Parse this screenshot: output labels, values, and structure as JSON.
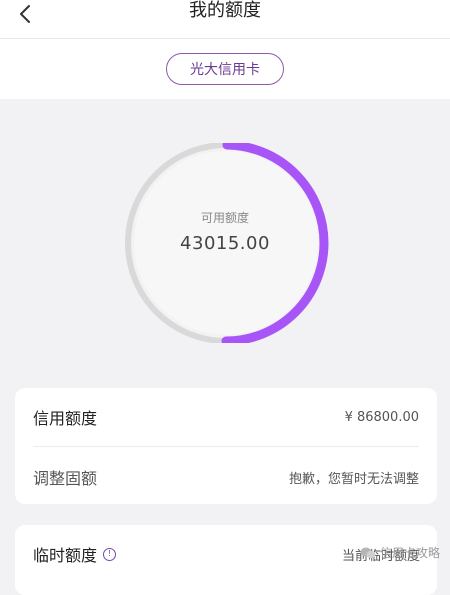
{
  "header": {
    "title": "我的额度",
    "back_icon": "chevron-left-icon"
  },
  "card_selector": {
    "label": "光大信用卡"
  },
  "gauge": {
    "label": "可用额度",
    "value": "43015.00",
    "used_fraction": 0.5,
    "accent_color": "#a855f7",
    "track_color": "#d9d9d9"
  },
  "limits": {
    "rows": [
      {
        "label": "信用额度",
        "value": "¥ 86800.00"
      },
      {
        "label": "调整固额",
        "value": "抱歉，您暂时无法调整"
      }
    ]
  },
  "temp_limit": {
    "label": "临时额度",
    "info_icon": "info-circle-icon",
    "value": "当前临时额度"
  },
  "watermark": {
    "text": "信用卡攻略"
  }
}
